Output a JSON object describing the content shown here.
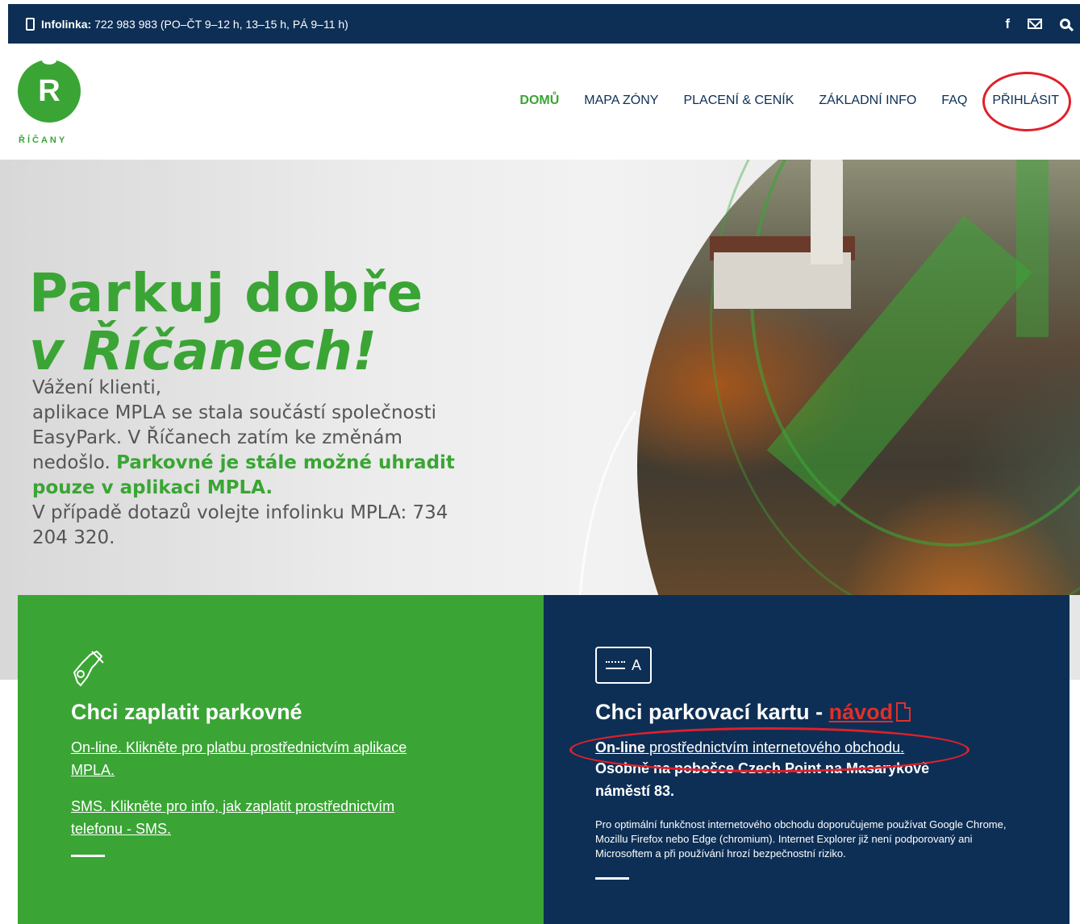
{
  "topbar": {
    "infolinka_label": "Infolinka:",
    "infolinka_text": "722 983 983 (PO–ČT 9–12 h, 13–15 h, PÁ 9–11 h)",
    "icons": [
      "facebook-icon",
      "mail-icon",
      "search-icon"
    ],
    "facebook_glyph": "f"
  },
  "header": {
    "logo_letter": "R",
    "logo_text": "ŘÍČANY",
    "nav": [
      {
        "label": "DOMŮ",
        "active": true
      },
      {
        "label": "MAPA ZÓNY"
      },
      {
        "label": "PLACENÍ & CENÍK"
      },
      {
        "label": "ZÁKLADNÍ INFO"
      },
      {
        "label": "FAQ"
      },
      {
        "label": "PŘIHLÁSIT"
      }
    ]
  },
  "hero": {
    "title_line1": "Parkuj dobře",
    "title_line2": "v Říčanech!",
    "text_1": "Vážení klienti,",
    "text_2": "aplikace MPLA se stala součástí společnosti EasyPark. V Říčanech zatím ke změnám nedošlo.",
    "text_highlight": "Parkovné je stále možné uhradit pouze v aplikaci MPLA.",
    "text_3": "V případě dotazů volejte infolinku MPLA: 734 204 320."
  },
  "card_pay": {
    "title": "Chci zaplatit parkovné",
    "link_online": "On-line. Klikněte pro platbu prostřednictvím aplikace MPLA.",
    "link_sms": "SMS. Klikněte pro info, jak zaplatit prostřednictvím telefonu - SMS."
  },
  "card_card": {
    "title": "Chci parkovací kartu - ",
    "title_link": "návod",
    "icon_letter": "A",
    "online_bold": "On-line",
    "online_text": " prostřednictvím internetového obchodu.",
    "osobne": "Osobně na pobočce Czech Point na Masarykově náměstí 83.",
    "note": "Pro optimální funkčnost internetového obchodu doporučujeme používat Google Chrome, Mozillu Firefox nebo Edge (chromium). Internet Explorer již není podporovaný ani Microsoftem a při používání hrozí bezpečnostní riziko."
  },
  "colors": {
    "navy": "#0d2f55",
    "green": "#3aa535",
    "annotation_red": "#e0202a"
  }
}
